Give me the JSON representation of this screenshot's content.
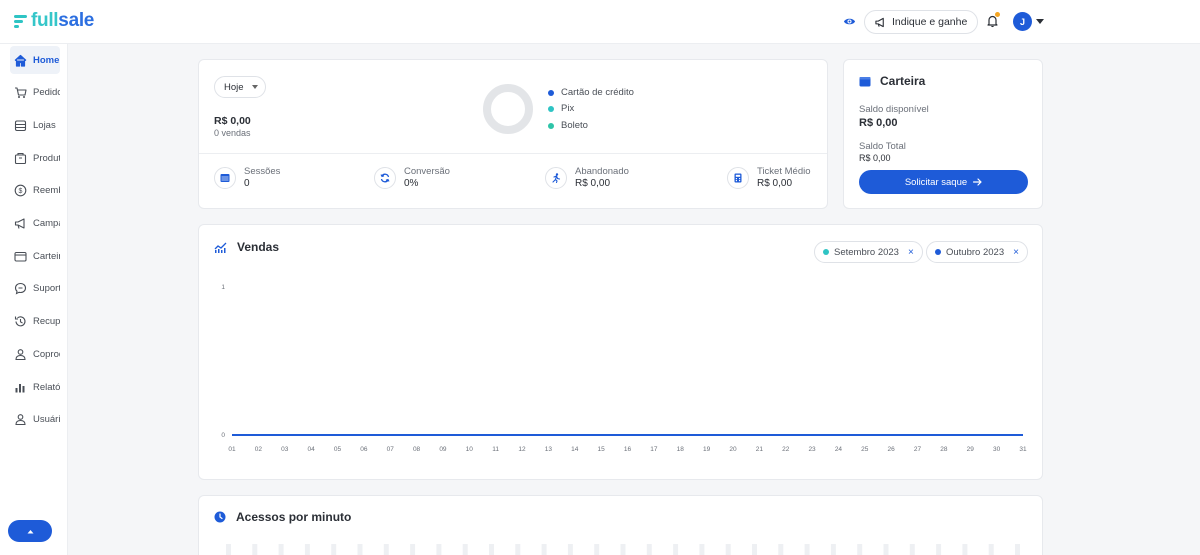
{
  "brand": {
    "logo_full": "full",
    "logo_sale": "sale"
  },
  "header": {
    "refer_label": "Indique e ganhe",
    "avatar_initial": "J"
  },
  "sidebar": {
    "items": [
      {
        "label": "Home",
        "icon": "home-icon",
        "active": true
      },
      {
        "label": "Pedidos",
        "icon": "cart-icon"
      },
      {
        "label": "Lojas",
        "icon": "store-icon"
      },
      {
        "label": "Produtos",
        "icon": "box-icon"
      },
      {
        "label": "Reembolsos",
        "icon": "refund-icon"
      },
      {
        "label": "Campanhas",
        "icon": "megaphone-icon"
      },
      {
        "label": "Carteira",
        "icon": "wallet-icon"
      },
      {
        "label": "Suporte",
        "icon": "chat-icon"
      },
      {
        "label": "Recuperação",
        "icon": "history-icon"
      },
      {
        "label": "Coprodução",
        "icon": "users-icon"
      },
      {
        "label": "Relatórios",
        "icon": "bar-chart-icon"
      },
      {
        "label": "Usuários",
        "icon": "user-icon"
      }
    ]
  },
  "summary": {
    "period": "Hoje",
    "revenue": "R$ 0,00",
    "sales_count": "0 vendas",
    "legend": [
      {
        "label": "Cartão de crédito",
        "color": "#1e5bd8"
      },
      {
        "label": "Pix",
        "color": "#2ec4c4"
      },
      {
        "label": "Boleto",
        "color": "#2ec4a8"
      }
    ],
    "stats": [
      {
        "label": "Sessões",
        "value": "0",
        "icon": "browser-icon"
      },
      {
        "label": "Conversão",
        "value": "0%",
        "icon": "refresh-icon"
      },
      {
        "label": "Abandonado",
        "value": "R$ 0,00",
        "icon": "running-icon"
      },
      {
        "label": "Ticket Médio",
        "value": "R$ 0,00",
        "icon": "calculator-icon"
      }
    ]
  },
  "wallet": {
    "title": "Carteira",
    "available_label": "Saldo disponível",
    "available_value": "R$ 0,00",
    "total_label": "Saldo Total",
    "total_value": "R$ 0,00",
    "withdraw_label": "Solicitar saque"
  },
  "sales": {
    "title": "Vendas",
    "filters": [
      {
        "label": "Setembro 2023",
        "color": "#2ec4c4",
        "remove": "×"
      },
      {
        "label": "Outubro 2023",
        "color": "#1e5bd8",
        "remove": "×"
      }
    ]
  },
  "chart_data": {
    "type": "line",
    "x": [
      "01",
      "02",
      "03",
      "04",
      "05",
      "06",
      "07",
      "08",
      "09",
      "10",
      "11",
      "12",
      "13",
      "14",
      "15",
      "16",
      "17",
      "18",
      "19",
      "20",
      "21",
      "22",
      "23",
      "24",
      "25",
      "26",
      "27",
      "28",
      "29",
      "30",
      "31"
    ],
    "series": [
      {
        "name": "Setembro 2023",
        "color": "#2ec4c4",
        "values": [
          0,
          0,
          0,
          0,
          0,
          0,
          0,
          0,
          0,
          0,
          0,
          0,
          0,
          0,
          0,
          0,
          0,
          0,
          0,
          0,
          0,
          0,
          0,
          0,
          0,
          0,
          0,
          0,
          0,
          0,
          0
        ]
      },
      {
        "name": "Outubro 2023",
        "color": "#1e5bd8",
        "values": [
          0,
          0,
          0,
          0,
          0,
          0,
          0,
          0,
          0,
          0,
          0,
          0,
          0,
          0,
          0,
          0,
          0,
          0,
          0,
          0,
          0,
          0,
          0,
          0,
          0,
          0,
          0,
          0,
          0,
          0,
          0
        ]
      }
    ],
    "ylim": [
      0,
      1
    ],
    "yticks": [
      "0",
      "1"
    ],
    "grid": false,
    "legend": "top-right"
  },
  "access": {
    "title": "Acessos por minuto"
  }
}
